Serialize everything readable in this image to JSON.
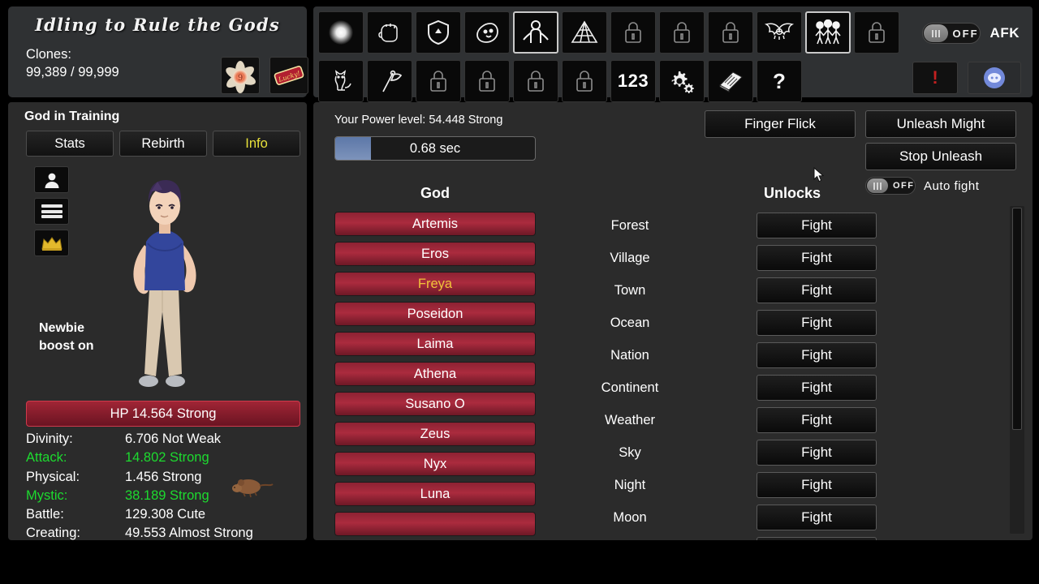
{
  "header": {
    "title": "Idling to Rule the Gods",
    "clones_label": "Clones:",
    "clones_value": "99,389 / 99,999",
    "items": [
      {
        "name": "flower-orb-item",
        "label": "Flower Orb"
      },
      {
        "name": "lucky-ticket-item",
        "label": "Lucky"
      }
    ]
  },
  "toolbar": {
    "row1": [
      {
        "icon": "orb-icon",
        "label": "Orb",
        "selected": false,
        "locked": false
      },
      {
        "icon": "fist-icon",
        "label": "Fist",
        "selected": false,
        "locked": false
      },
      {
        "icon": "shield-icon",
        "label": "Shield",
        "selected": false,
        "locked": false
      },
      {
        "icon": "slime-icon",
        "label": "Slime",
        "selected": false,
        "locked": false
      },
      {
        "icon": "human-figure-icon",
        "label": "Training",
        "selected": true,
        "locked": false
      },
      {
        "icon": "pyramid-icon",
        "label": "Pyramid",
        "selected": false,
        "locked": false
      },
      {
        "icon": "lock-icon",
        "label": "Locked",
        "selected": false,
        "locked": true
      },
      {
        "icon": "lock-icon",
        "label": "Locked",
        "selected": false,
        "locked": true
      },
      {
        "icon": "lock-icon",
        "label": "Locked",
        "selected": false,
        "locked": true
      },
      {
        "icon": "bat-wings-icon",
        "label": "Monsters",
        "selected": false,
        "locked": false
      },
      {
        "icon": "three-people-icon",
        "label": "Gods",
        "selected": true,
        "locked": false
      },
      {
        "icon": "lock-icon",
        "label": "Locked",
        "selected": false,
        "locked": true
      }
    ],
    "row2": [
      {
        "icon": "cat-icon",
        "label": "Pet",
        "selected": false,
        "locked": false
      },
      {
        "icon": "flag-icon",
        "label": "Flag",
        "selected": false,
        "locked": false
      },
      {
        "icon": "lock-icon",
        "label": "Locked",
        "selected": false,
        "locked": true
      },
      {
        "icon": "lock-icon",
        "label": "Locked",
        "selected": false,
        "locked": true
      },
      {
        "icon": "lock-icon",
        "label": "Locked",
        "selected": false,
        "locked": true
      },
      {
        "icon": "lock-icon",
        "label": "Locked",
        "selected": false,
        "locked": true
      },
      {
        "icon": "numbers-icon",
        "label": "123",
        "selected": false,
        "locked": false
      },
      {
        "icon": "gear-icon",
        "label": "Settings",
        "selected": false,
        "locked": false
      },
      {
        "icon": "book-icon",
        "label": "Guide",
        "selected": false,
        "locked": false
      },
      {
        "icon": "question-mark-icon",
        "label": "Help",
        "selected": false,
        "locked": false
      }
    ],
    "afk": {
      "label": "AFK",
      "state": "OFF"
    },
    "alert": {
      "icon": "exclamation-icon",
      "label": "!"
    },
    "discord": {
      "icon": "discord-icon",
      "label": "Discord"
    }
  },
  "character": {
    "title": "God in Training",
    "tabs": [
      {
        "label": "Stats",
        "active": false
      },
      {
        "label": "Rebirth",
        "active": false
      },
      {
        "label": "Info",
        "active": true
      }
    ],
    "side_icons": [
      {
        "icon": "person-icon",
        "label": "Character"
      },
      {
        "icon": "menu-icon",
        "label": "Menu"
      },
      {
        "icon": "crown-icon",
        "label": "Crown"
      }
    ],
    "newbie_boost": "Newbie\nboost on",
    "newbie_boost_line1": "Newbie",
    "newbie_boost_line2": "boost on",
    "hp": "HP 14.564 Strong",
    "stats": [
      {
        "key": "Divinity:",
        "value": "6.706 Not Weak",
        "highlight": false
      },
      {
        "key": "Attack:",
        "value": "14.802 Strong",
        "highlight": true
      },
      {
        "key": "Physical:",
        "value": "1.456 Strong",
        "highlight": false
      },
      {
        "key": "Mystic:",
        "value": "38.189 Strong",
        "highlight": true
      },
      {
        "key": "Battle:",
        "value": "129.308 Cute",
        "highlight": false
      },
      {
        "key": "Creating:",
        "value": "49.553 Almost Strong",
        "highlight": false
      }
    ]
  },
  "main": {
    "power_level": "Your Power level: 54.448 Strong",
    "timer_text": "0.68 sec",
    "timer_percent": 18,
    "finger_flick": "Finger Flick",
    "unleash_might": "Unleash Might",
    "stop_unleash": "Stop Unleash",
    "auto_fight": {
      "label": "Auto fight",
      "state": "OFF"
    },
    "god_column_title": "God",
    "gods": [
      {
        "name": "Artemis",
        "selected": false
      },
      {
        "name": "Eros",
        "selected": false
      },
      {
        "name": "Freya",
        "selected": true
      },
      {
        "name": "Poseidon",
        "selected": false
      },
      {
        "name": "Laima",
        "selected": false
      },
      {
        "name": "Athena",
        "selected": false
      },
      {
        "name": "Susano O",
        "selected": false
      },
      {
        "name": "Zeus",
        "selected": false
      },
      {
        "name": "Nyx",
        "selected": false
      },
      {
        "name": "Luna",
        "selected": false
      }
    ],
    "unlocks_column_title": "Unlocks",
    "fight_label": "Fight",
    "unlocks": [
      {
        "name": "Forest"
      },
      {
        "name": "Village"
      },
      {
        "name": "Town"
      },
      {
        "name": "Ocean"
      },
      {
        "name": "Nation"
      },
      {
        "name": "Continent"
      },
      {
        "name": "Weather"
      },
      {
        "name": "Sky"
      },
      {
        "name": "Night"
      },
      {
        "name": "Moon"
      }
    ]
  },
  "colors": {
    "panel_bg": "#2b2b2b",
    "god_button": "#ab2b3e",
    "selected_text": "#f0c23a",
    "stat_highlight": "#1ddb2f",
    "hp_bar": "#a02535",
    "timer_fill": "#5d78a8",
    "discord": "#7289da"
  }
}
